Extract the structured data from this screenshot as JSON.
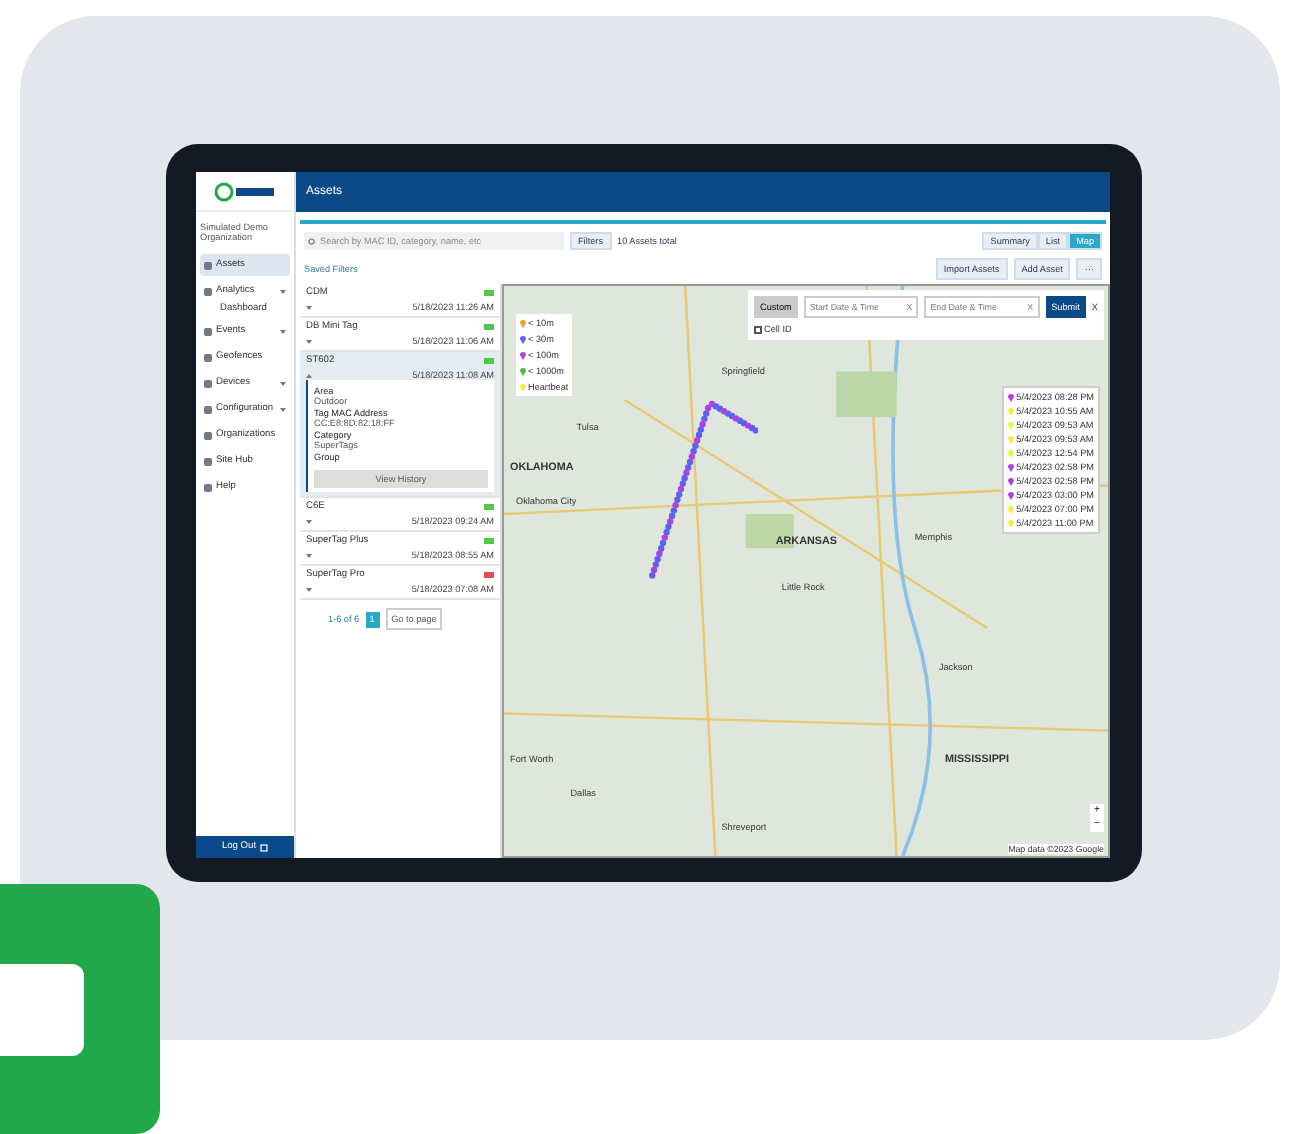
{
  "header": {
    "title": "Assets"
  },
  "sidebar": {
    "org": "Simulated Demo Organization",
    "items": [
      {
        "label": "Assets",
        "selected": true,
        "expandable": false
      },
      {
        "label": "Analytics",
        "selected": false,
        "expandable": true,
        "children": [
          {
            "label": "Dashboard",
            "selected": false
          }
        ]
      },
      {
        "label": "Events",
        "selected": false,
        "expandable": true
      },
      {
        "label": "Geofences",
        "selected": false,
        "expandable": false
      },
      {
        "label": "Devices",
        "selected": false,
        "expandable": true
      },
      {
        "label": "Configuration",
        "selected": false,
        "expandable": true
      },
      {
        "label": "Organizations",
        "selected": false,
        "expandable": false
      },
      {
        "label": "Site Hub",
        "selected": false,
        "expandable": false
      },
      {
        "label": "Help",
        "selected": false,
        "expandable": false
      }
    ],
    "logout": "Log Out"
  },
  "toolbar": {
    "search_placeholder": "Search by MAC ID, category, name, etc",
    "filters": "Filters",
    "total": "10 Assets total",
    "views": [
      {
        "label": "Summary",
        "selected": false
      },
      {
        "label": "List",
        "selected": false
      },
      {
        "label": "Map",
        "selected": true
      }
    ],
    "import": "Import Assets",
    "add": "Add Asset",
    "more": "···",
    "saved_filters": "Saved Filters"
  },
  "assets": [
    {
      "name": "CDM",
      "date": "5/18/2023 11:26 AM",
      "color": "#4cc94c",
      "expanded": false
    },
    {
      "name": "DB Mini Tag",
      "date": "5/18/2023 11:06 AM",
      "color": "#4cc94c",
      "expanded": false
    },
    {
      "name": "ST602",
      "date": "5/18/2023 11:08 AM",
      "color": "#4cc94c",
      "expanded": true,
      "details": [
        {
          "label": "Area",
          "value": "Outdoor"
        },
        {
          "label": "Tag MAC Address",
          "value": "CC:E8:8D:82:18:FF"
        },
        {
          "label": "Category",
          "value": "SuperTags"
        },
        {
          "label": "Group"
        }
      ],
      "button": "View History"
    },
    {
      "name": "C6E",
      "date": "5/18/2023 09:24 AM",
      "color": "#4cc94c",
      "expanded": false
    },
    {
      "name": "SuperTag Plus",
      "date": "5/18/2023 08:55 AM",
      "color": "#4cc94c",
      "expanded": false
    },
    {
      "name": "SuperTag Pro",
      "date": "5/18/2023 07:08 AM",
      "color": "#e05050",
      "expanded": false
    }
  ],
  "pagination": {
    "label": "1-6 of 6",
    "pages": [
      {
        "label": "1",
        "selected": true
      }
    ],
    "goto": "Go to page"
  },
  "map": {
    "mode": "Custom",
    "start_placeholder": "Start Date & Time",
    "start_clear": "X",
    "end_placeholder": "End Date & Time",
    "end_clear": "X",
    "submit": "Submit",
    "close": "X",
    "cell_id": {
      "label": "Cell ID",
      "checked": false
    },
    "legend": [
      {
        "label": "< 10m",
        "color": "#f0a030"
      },
      {
        "label": "< 30m",
        "color": "#6060f0"
      },
      {
        "label": "< 100m",
        "color": "#b040e0"
      },
      {
        "label": "< 1000m",
        "color": "#40c040"
      },
      {
        "label": "Heartbeat",
        "color": "#f0f040"
      }
    ],
    "timeline": [
      {
        "time": "5/4/2023 08:28 PM",
        "color": "#b040e0"
      },
      {
        "time": "5/4/2023 10:55 AM",
        "color": "#f0f040"
      },
      {
        "time": "5/4/2023 09:53 AM",
        "color": "#f0f040"
      },
      {
        "time": "5/4/2023 09:53 AM",
        "color": "#f0f040"
      },
      {
        "time": "5/4/2023 12:54 PM",
        "color": "#f0f040"
      },
      {
        "time": "5/4/2023 02:58 PM",
        "color": "#b040e0"
      },
      {
        "time": "5/4/2023 02:58 PM",
        "color": "#b040e0"
      },
      {
        "time": "5/4/2023 03:00 PM",
        "color": "#b040e0"
      },
      {
        "time": "5/4/2023 07:00 PM",
        "color": "#f0f040"
      },
      {
        "time": "5/4/2023 11:00 PM",
        "color": "#f0f040"
      }
    ],
    "places": [
      {
        "label": "OKLAHOMA",
        "kind": "state"
      },
      {
        "label": "ARKANSAS",
        "kind": "state"
      },
      {
        "label": "MISSISSIPPI",
        "kind": "state"
      },
      {
        "label": "Oklahoma City",
        "kind": "city"
      },
      {
        "label": "Tulsa",
        "kind": "city"
      },
      {
        "label": "Springfield",
        "kind": "city"
      },
      {
        "label": "Little Rock",
        "kind": "city"
      },
      {
        "label": "Memphis",
        "kind": "city"
      },
      {
        "label": "Dallas",
        "kind": "city"
      },
      {
        "label": "Fort Worth",
        "kind": "city"
      },
      {
        "label": "Shreveport",
        "kind": "city"
      },
      {
        "label": "Jackson",
        "kind": "city"
      }
    ],
    "zoom_in": "+",
    "zoom_out": "−",
    "attribution": "Map data ©2023 Google"
  }
}
